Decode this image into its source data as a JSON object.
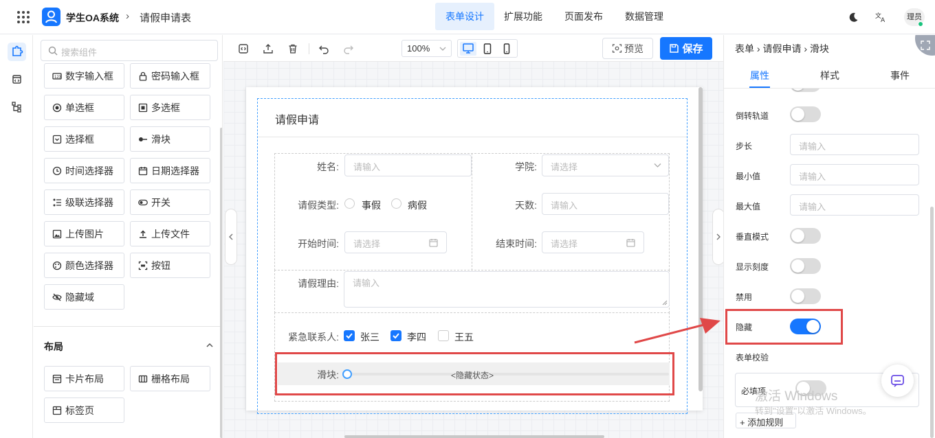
{
  "header": {
    "app_title": "学生OA系统",
    "breadcrumb_sep": "›",
    "page_title": "请假申请表",
    "tabs": [
      {
        "label": "表单设计",
        "active": true
      },
      {
        "label": "扩展功能",
        "active": false
      },
      {
        "label": "页面发布",
        "active": false
      },
      {
        "label": "数据管理",
        "active": false
      }
    ],
    "icons": [
      "apps-grid-icon",
      "user-logo-icon",
      "moon-icon",
      "translate-icon"
    ],
    "avatar_text": "理员",
    "avatar_status_color": "#19c37d"
  },
  "rail": {
    "icons": [
      "puzzle-icon",
      "code-window-icon",
      "tree-icon"
    ]
  },
  "component_panel": {
    "search_placeholder": "搜索组件",
    "components": [
      {
        "label": "数字输入框",
        "icon": "number-input-icon"
      },
      {
        "label": "密码输入框",
        "icon": "lock-icon"
      },
      {
        "label": "单选框",
        "icon": "radio-icon"
      },
      {
        "label": "多选框",
        "icon": "checkbox-icon"
      },
      {
        "label": "选择框",
        "icon": "select-icon"
      },
      {
        "label": "滑块",
        "icon": "slider-icon"
      },
      {
        "label": "时间选择器",
        "icon": "clock-icon"
      },
      {
        "label": "日期选择器",
        "icon": "calendar-icon"
      },
      {
        "label": "级联选择器",
        "icon": "cascader-icon"
      },
      {
        "label": "开关",
        "icon": "switch-icon"
      },
      {
        "label": "上传图片",
        "icon": "image-icon"
      },
      {
        "label": "上传文件",
        "icon": "upload-icon"
      },
      {
        "label": "颜色选择器",
        "icon": "palette-icon"
      },
      {
        "label": "按钮",
        "icon": "button-icon"
      },
      {
        "label": "隐藏域",
        "icon": "eye-off-icon"
      }
    ],
    "layout_section": {
      "title": "布局",
      "components": [
        {
          "label": "卡片布局",
          "icon": "card-icon"
        },
        {
          "label": "栅格布局",
          "icon": "grid-layout-icon"
        },
        {
          "label": "标签页",
          "icon": "tabs-icon"
        }
      ]
    }
  },
  "toolbar": {
    "zoom": "100%",
    "preview_label": "预览",
    "save_label": "保存",
    "accent": "#1677ff"
  },
  "form": {
    "title": "请假申请",
    "fields": {
      "name": {
        "label": "姓名:",
        "placeholder": "请输入"
      },
      "college": {
        "label": "学院:",
        "placeholder": "请选择"
      },
      "leave_type": {
        "label": "请假类型:",
        "options": [
          "事假",
          "病假"
        ]
      },
      "days": {
        "label": "天数:",
        "placeholder": "请输入"
      },
      "start_time": {
        "label": "开始时间:",
        "placeholder": "请选择"
      },
      "end_time": {
        "label": "结束时间:",
        "placeholder": "请选择"
      },
      "reason": {
        "label": "请假理由:",
        "placeholder": "请输入"
      },
      "contacts": {
        "label": "紧急联系人:",
        "options": [
          {
            "label": "张三",
            "checked": true
          },
          {
            "label": "李四",
            "checked": true
          },
          {
            "label": "王五",
            "checked": false
          }
        ]
      },
      "slider": {
        "label": "滑块:",
        "status": "<隐藏状态>"
      }
    }
  },
  "props": {
    "breadcrumb": "表单 › 请假申请 › 滑块",
    "tabs": [
      {
        "label": "属性",
        "active": true
      },
      {
        "label": "样式",
        "active": false
      },
      {
        "label": "事件",
        "active": false
      }
    ],
    "reverse_label": "倒转轨道",
    "reverse": false,
    "step_label": "步长",
    "step_placeholder": "请输入",
    "min_label": "最小值",
    "min_placeholder": "请输入",
    "max_label": "最大值",
    "max_placeholder": "请输入",
    "vertical_label": "垂直模式",
    "vertical": false,
    "ticks_label": "显示刻度",
    "ticks": false,
    "disabled_label": "禁用",
    "disabled": false,
    "hidden_label": "隐藏",
    "hidden": true,
    "validation_title": "表单校验",
    "required_label": "必填项",
    "required": false,
    "add_rule_label": "+ 添加规则"
  },
  "watermark": {
    "line1": "激活 Windows",
    "line2": "转到\"设置\"以激活 Windows。"
  },
  "annotation_color": "#e04848"
}
